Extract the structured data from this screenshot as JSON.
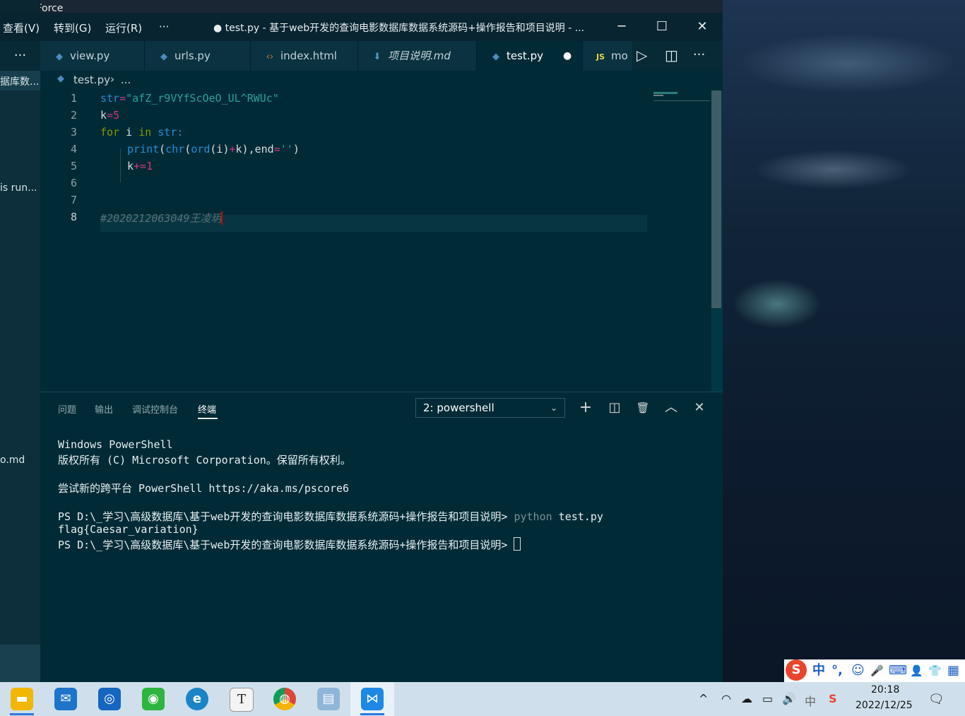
{
  "desktop": {
    "top_app_label": "GeForce"
  },
  "left_window": {
    "items": [
      "据库数...",
      "is run...",
      "o.md"
    ]
  },
  "vscode": {
    "menu": [
      "查看(V)",
      "转到(G)",
      "运行(R)",
      "···"
    ],
    "window_title": "● test.py - 基于web开发的查询电影数据库数据系统源码+操作报告和项目说明 - ...",
    "window_controls": {
      "minimize": "─",
      "maximize": "☐",
      "close": "✕"
    },
    "tabs": [
      {
        "label": "view.py",
        "icon": "python-icon"
      },
      {
        "label": "urls.py",
        "icon": "python-icon"
      },
      {
        "label": "index.html",
        "icon": "html-icon"
      },
      {
        "label": "项目说明.md",
        "icon": "markdown-icon"
      },
      {
        "label": "test.py",
        "icon": "python-icon",
        "active": true,
        "modified": true
      },
      {
        "label": "mo",
        "icon": "javascript-icon"
      }
    ],
    "tab_actions": {
      "run": "▷",
      "split": "◫",
      "more": "···"
    },
    "more_glyph": "···",
    "modified_dot": "●",
    "js_badge": "JS",
    "breadcrumb": {
      "file": "test.py",
      "sep": "›",
      "rest": "..."
    },
    "editor": {
      "line_numbers": [
        "1",
        "2",
        "3",
        "4",
        "5",
        "6",
        "7",
        "8"
      ],
      "line1": {
        "var": "str",
        "op": "=",
        "str": "\"afZ_r9VYfScOeO_UL^RWUc\""
      },
      "line2": {
        "var": "k",
        "op": "=",
        "num": "5"
      },
      "line3": {
        "kw1": "for",
        "var": " i ",
        "kw2": "in",
        "rest": " str:"
      },
      "line4": {
        "fn": "print",
        "p1": "(",
        "fn2": "chr",
        "p2": "(",
        "fn3": "ord",
        "args": "(i)",
        "op": "+",
        "k": "k),end",
        "eq": "=",
        "str": "''",
        "close": ")"
      },
      "line5": {
        "var": "k",
        "op": "+=",
        "num": "1"
      },
      "line8": {
        "comment": "#2020212063049王凌玥"
      }
    },
    "panel": {
      "tabs": [
        "问题",
        "输出",
        "调试控制台",
        "终端"
      ],
      "active_tab": "终端",
      "terminal_select": "2: powershell",
      "select_chevron": "⌄",
      "actions": {
        "new": "+",
        "split": "◫",
        "trash": "🗑",
        "maximize": "︿",
        "close": "✕"
      },
      "terminal_lines": [
        "Windows PowerShell",
        "版权所有 (C) Microsoft Corporation。保留所有权利。",
        "",
        "尝试新的跨平台 PowerShell https://aka.ms/pscore6",
        "",
        "PS D:\\_学习\\高级数据库\\基于web开发的查询电影数据库数据系统源码+操作报告和项目说明> ",
        "flag{Caesar_variation}",
        "PS D:\\_学习\\高级数据库\\基于web开发的查询电影数据库数据系统源码+操作报告和项目说明> "
      ],
      "command_python": "python",
      "command_arg": " test.py"
    }
  },
  "ime": {
    "logo": "S",
    "items": [
      "中",
      "°,",
      "☺",
      "🎤",
      "⌨",
      "👤",
      "👕",
      "▦"
    ]
  },
  "taskbar": {
    "apps": [
      {
        "name": "file-explorer",
        "glyph": "▬",
        "color": "#f2b705"
      },
      {
        "name": "mail",
        "glyph": "✉",
        "color": "#1e74c9"
      },
      {
        "name": "lens",
        "glyph": "◎",
        "color": "#1665c0"
      },
      {
        "name": "wechat",
        "glyph": "◉",
        "color": "#2fb341"
      },
      {
        "name": "edge",
        "glyph": "e",
        "color": "#1b84c7"
      },
      {
        "name": "typora",
        "glyph": "T",
        "color": "#f4f4f4"
      },
      {
        "name": "chrome",
        "glyph": "◍",
        "color": "#db4437"
      },
      {
        "name": "notebook",
        "glyph": "▤",
        "color": "#8fb6d8"
      },
      {
        "name": "vscode",
        "glyph": "⋈",
        "color": "#1e88e5"
      }
    ],
    "tray": [
      "^",
      "◠",
      "☁",
      "▭",
      "🔊",
      "中",
      "S"
    ],
    "time": "20:18",
    "date": "2022/12/25",
    "notification": "🗨"
  }
}
